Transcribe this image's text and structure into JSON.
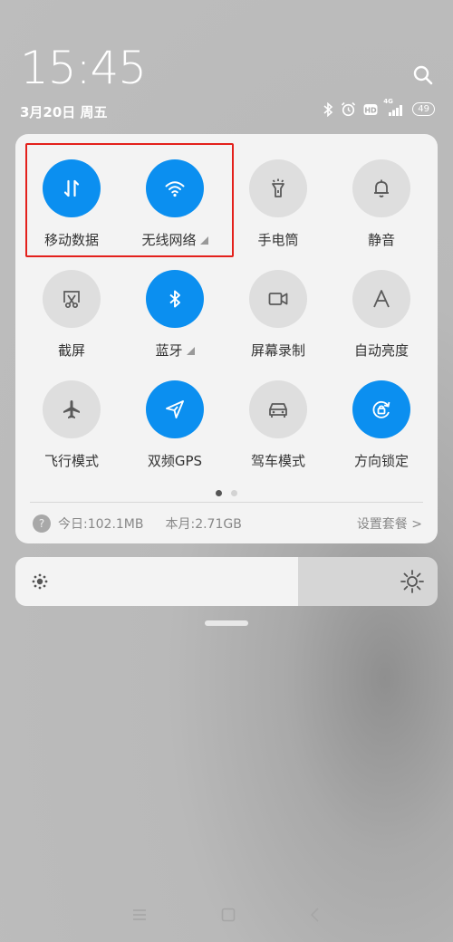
{
  "status": {
    "time": "15:45",
    "date": "3月20日 周五",
    "network_type": "4G",
    "battery": "49"
  },
  "tiles": [
    {
      "label": "移动数据",
      "on": true,
      "icon": "mobile-data-icon",
      "expandable": false
    },
    {
      "label": "无线网络",
      "on": true,
      "icon": "wifi-icon",
      "expandable": true
    },
    {
      "label": "手电筒",
      "on": false,
      "icon": "flashlight-icon",
      "expandable": false
    },
    {
      "label": "静音",
      "on": false,
      "icon": "bell-icon",
      "expandable": false
    },
    {
      "label": "截屏",
      "on": false,
      "icon": "screenshot-icon",
      "expandable": false
    },
    {
      "label": "蓝牙",
      "on": true,
      "icon": "bluetooth-icon",
      "expandable": true
    },
    {
      "label": "屏幕录制",
      "on": false,
      "icon": "screen-record-icon",
      "expandable": false
    },
    {
      "label": "自动亮度",
      "on": false,
      "icon": "auto-brightness-icon",
      "expandable": false
    },
    {
      "label": "飞行模式",
      "on": false,
      "icon": "airplane-icon",
      "expandable": false
    },
    {
      "label": "双频GPS",
      "on": true,
      "icon": "gps-icon",
      "expandable": false
    },
    {
      "label": "驾车模式",
      "on": false,
      "icon": "car-icon",
      "expandable": false
    },
    {
      "label": "方向锁定",
      "on": true,
      "icon": "rotation-lock-icon",
      "expandable": false
    }
  ],
  "page_indicator": {
    "total": 2,
    "current": 1
  },
  "usage": {
    "today": "今日:102.1MB",
    "month": "本月:2.71GB",
    "plan_link": "设置套餐 >"
  },
  "brightness": {
    "level": 0.67
  },
  "colors": {
    "accent": "#0b8ff0",
    "tile_off": "#dedede",
    "panel": "#f3f3f3",
    "highlight": "#e3201b"
  }
}
